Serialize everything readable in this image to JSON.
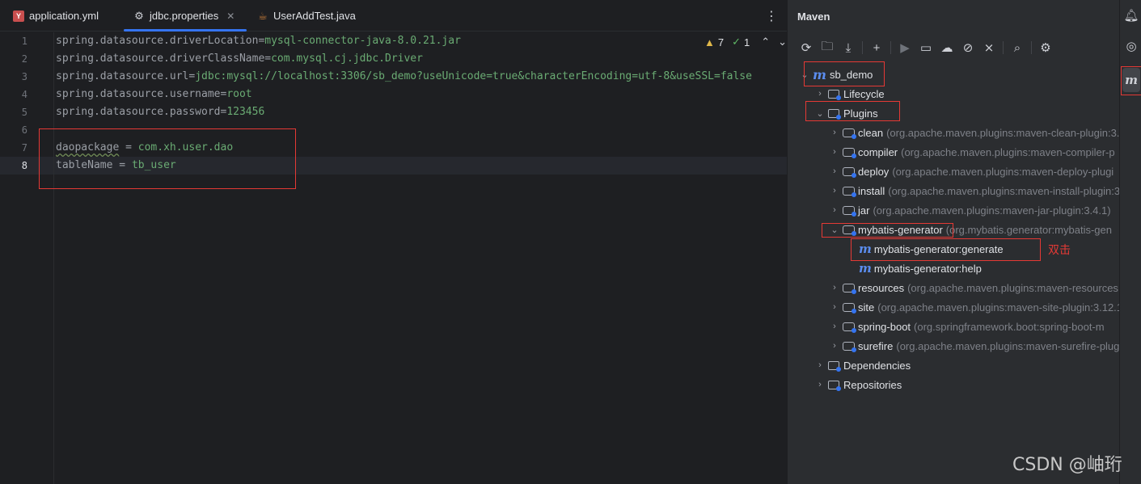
{
  "tabs": [
    {
      "label": "application.yml",
      "icon": "yaml-file-icon"
    },
    {
      "label": "jdbc.properties",
      "icon": "gear-icon",
      "active": true
    },
    {
      "label": "UserAddTest.java",
      "icon": "java-file-icon"
    }
  ],
  "inspections": {
    "warnings": "7",
    "ok": "1"
  },
  "code_lines": [
    {
      "num": "1",
      "key": "spring.datasource.driverLocation",
      "eq": "=",
      "val": "mysql-connector-java-8.0.21.jar"
    },
    {
      "num": "2",
      "key": "spring.datasource.driverClassName",
      "eq": "=",
      "val": "com.mysql.cj.jdbc.Driver"
    },
    {
      "num": "3",
      "key": "spring.datasource.url",
      "eq": "=",
      "val": "jdbc:mysql://localhost:3306/sb_demo?useUnicode=true&characterEncoding=utf-8&useSSL=false"
    },
    {
      "num": "4",
      "key": "spring.datasource.username",
      "eq": "=",
      "val": "root"
    },
    {
      "num": "5",
      "key": "spring.datasource.password",
      "eq": "=",
      "val": "123456"
    },
    {
      "num": "6",
      "key": "",
      "eq": "",
      "val": ""
    },
    {
      "num": "7",
      "key": "daopackage",
      "eq": " = ",
      "val": "com.xh.user.dao"
    },
    {
      "num": "8",
      "key": "tableName",
      "eq": " = ",
      "val": "tb_user"
    }
  ],
  "maven": {
    "title": "Maven",
    "root": "sb_demo",
    "lifecycle": "Lifecycle",
    "plugins": "Plugins",
    "plugin_items": [
      {
        "name": "clean",
        "coord": "(org.apache.maven.plugins:maven-clean-plugin:3."
      },
      {
        "name": "compiler",
        "coord": "(org.apache.maven.plugins:maven-compiler-p"
      },
      {
        "name": "deploy",
        "coord": "(org.apache.maven.plugins:maven-deploy-plugi"
      },
      {
        "name": "install",
        "coord": "(org.apache.maven.plugins:maven-install-plugin:3"
      },
      {
        "name": "jar",
        "coord": "(org.apache.maven.plugins:maven-jar-plugin:3.4.1)"
      },
      {
        "name": "mybatis-generator",
        "coord": "(org.mybatis.generator:mybatis-gen"
      }
    ],
    "goals": [
      "mybatis-generator:generate",
      "mybatis-generator:help"
    ],
    "annotation": "双击",
    "plugin_items_after": [
      {
        "name": "resources",
        "coord": "(org.apache.maven.plugins:maven-resources"
      },
      {
        "name": "site",
        "coord": "(org.apache.maven.plugins:maven-site-plugin:3.12.1"
      },
      {
        "name": "spring-boot",
        "coord": "(org.springframework.boot:spring-boot-m"
      },
      {
        "name": "surefire",
        "coord": "(org.apache.maven.plugins:maven-surefire-plug"
      }
    ],
    "dependencies": "Dependencies",
    "repositories": "Repositories"
  },
  "watermark": "CSDN @岫珩"
}
